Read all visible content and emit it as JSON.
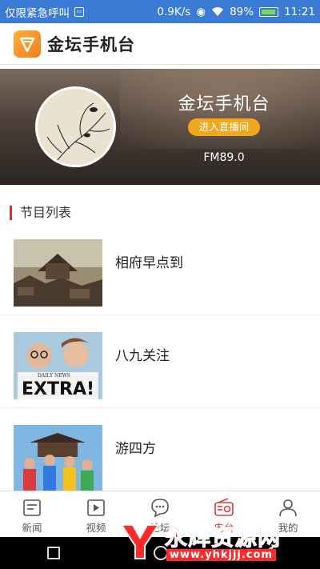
{
  "status_bar": {
    "carrier": "仅限紧急呼叫",
    "speed": "0.9K/s",
    "battery": "89%",
    "time": "11:21"
  },
  "header": {
    "title": "金坛手机台"
  },
  "hero": {
    "name": "金坛手机台",
    "live_button": "进入直播间",
    "frequency": "FM89.0"
  },
  "section": {
    "title": "节目列表"
  },
  "programs": [
    {
      "title": "相府早点到"
    },
    {
      "title": "八九关注"
    },
    {
      "title": "游四方"
    }
  ],
  "tabs": [
    {
      "label": "新闻",
      "icon": "news-icon"
    },
    {
      "label": "视频",
      "icon": "video-icon"
    },
    {
      "label": "论坛",
      "icon": "forum-icon"
    },
    {
      "label": "电台",
      "icon": "radio-icon"
    },
    {
      "label": "我的",
      "icon": "profile-icon"
    }
  ],
  "colors": {
    "status_bar": "#3a7bd5",
    "accent_red": "#e23c3c",
    "live_button": "#f0a81e"
  },
  "watermark": {
    "text": "永辉资源网",
    "url": "www.yhkjjj.com"
  }
}
